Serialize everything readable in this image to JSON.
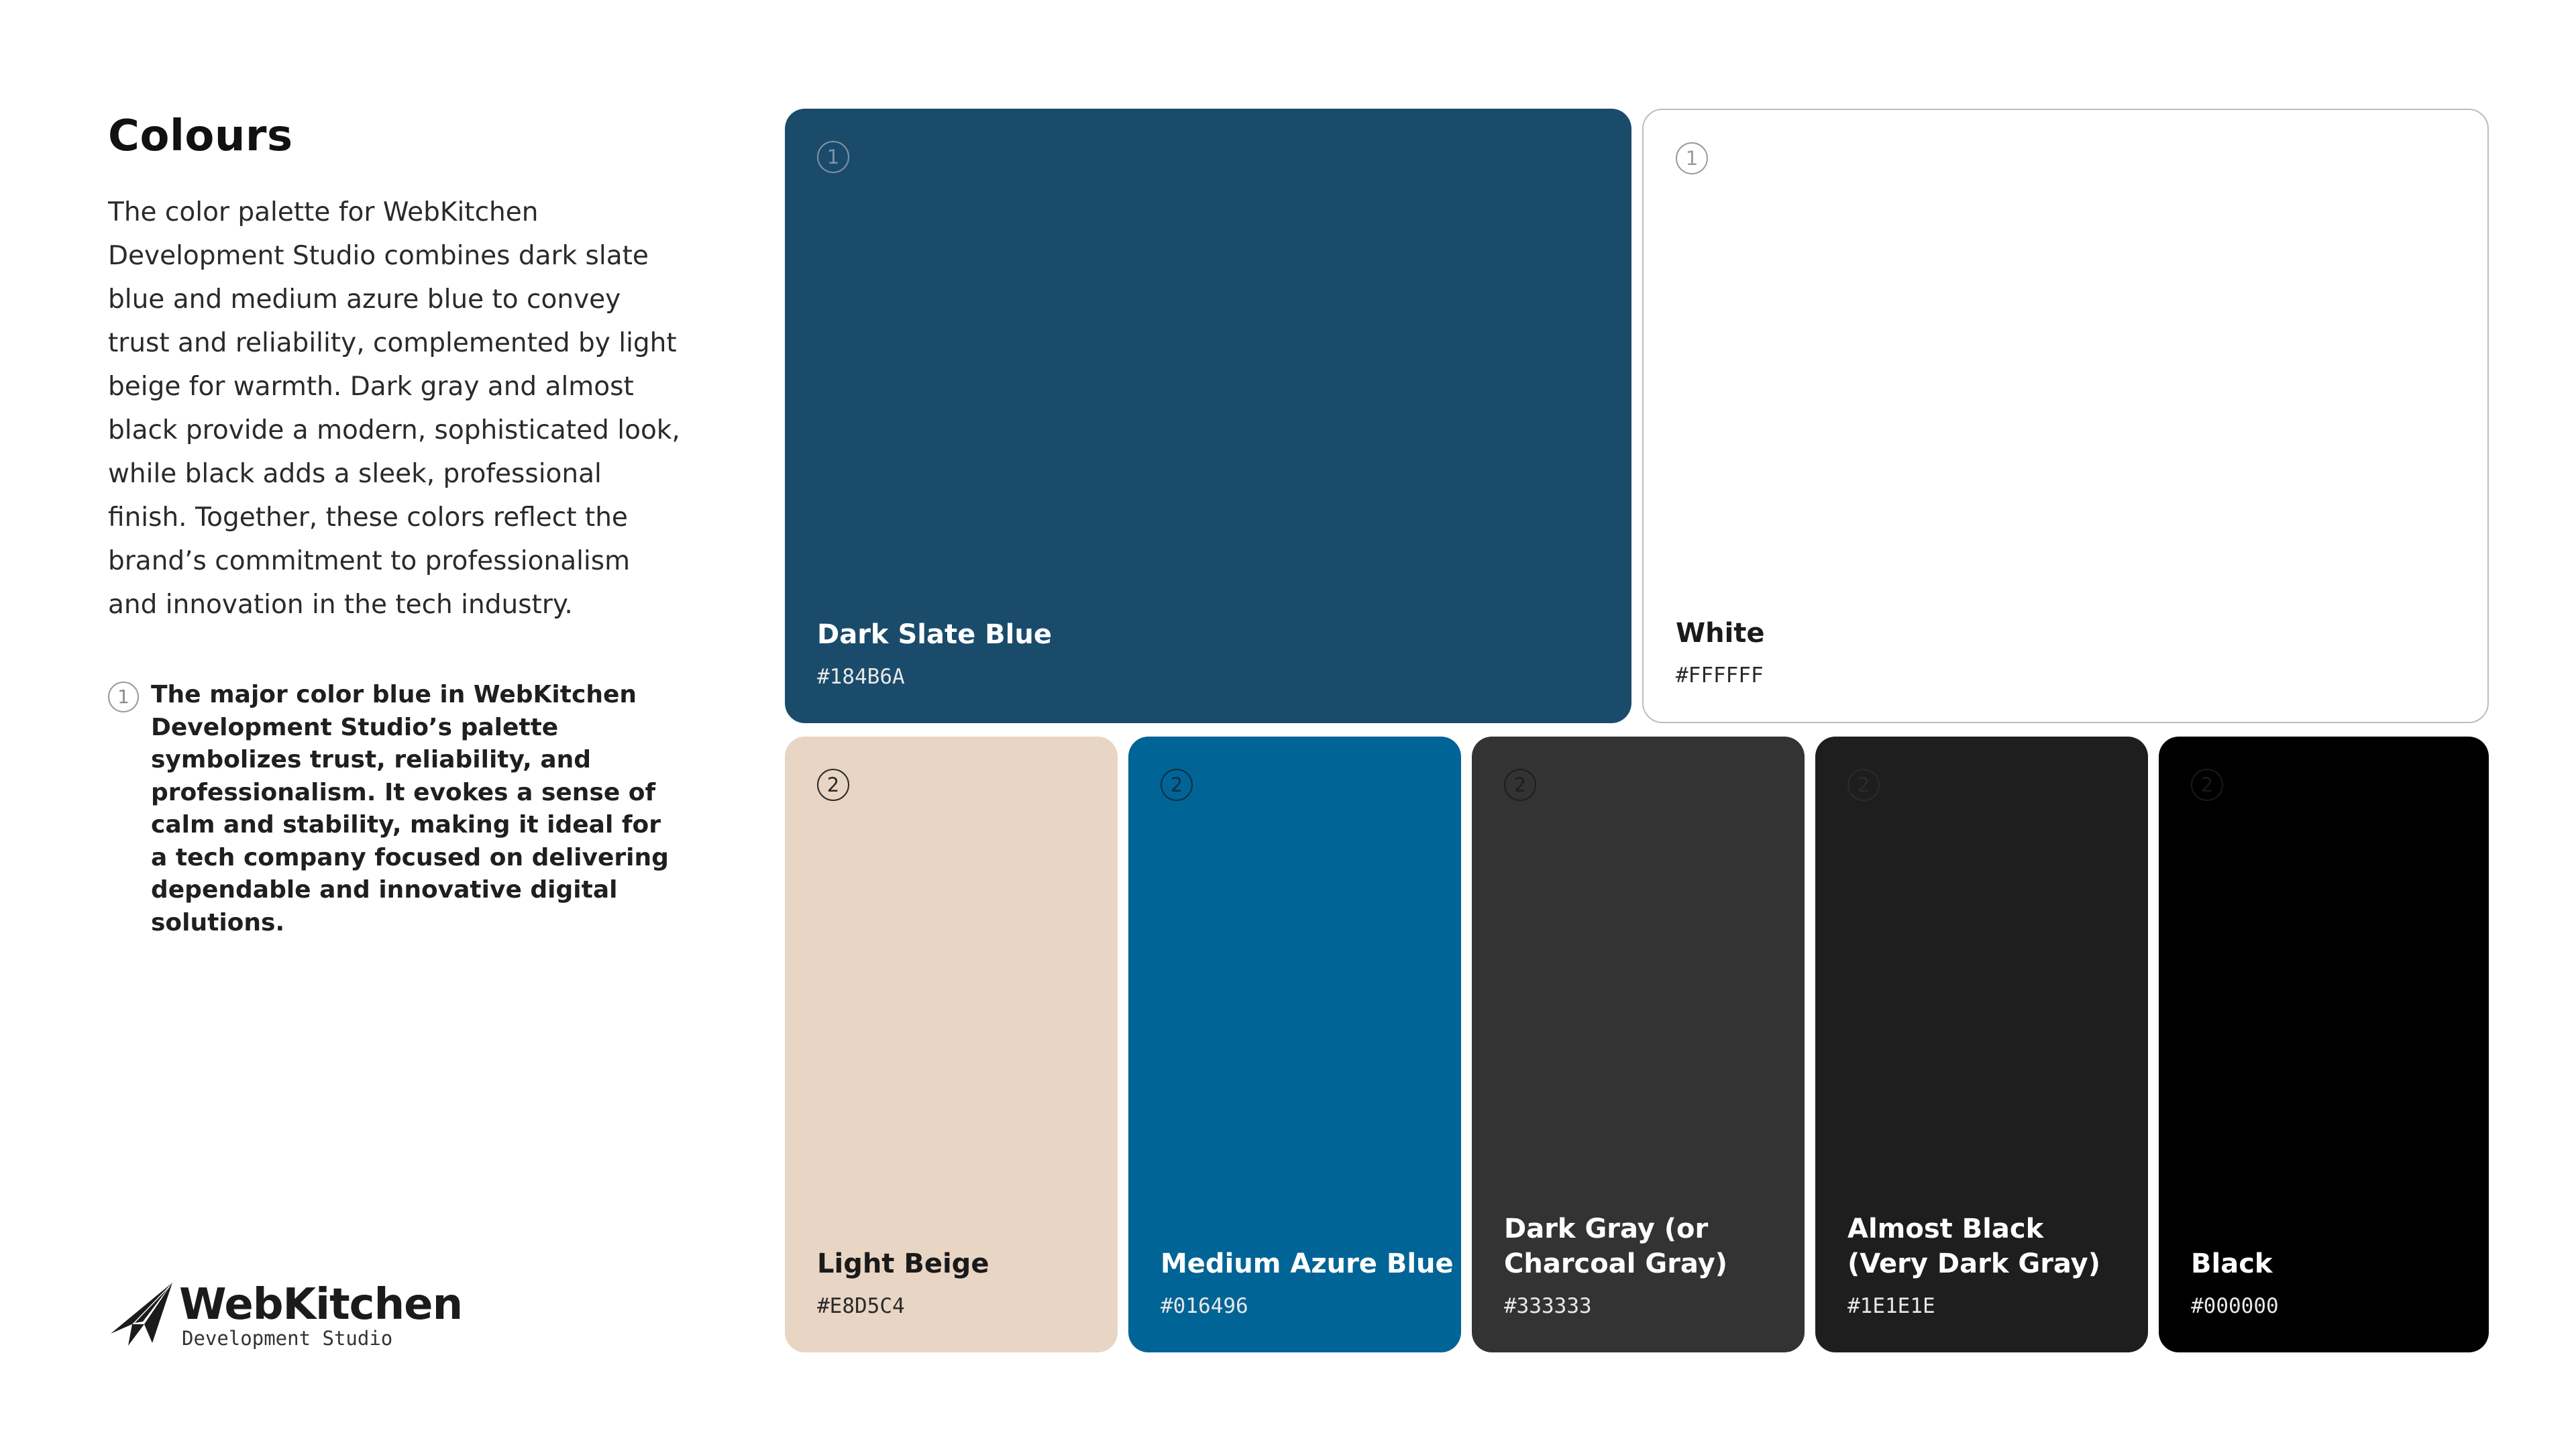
{
  "heading": "Colours",
  "description": "The color palette for WebKitchen Development Studio combines dark slate blue and medium azure blue to convey trust and reliability, complemented by light beige for warmth. Dark gray and almost black provide a modern, sophisticated look, while black adds a sleek, professional finish. Together, these colors reflect the brand’s commitment to professionalism and innovation in the tech industry.",
  "note": {
    "number": "1",
    "text": "The major color blue in WebKitchen Development Studio’s palette symbolizes trust, reliability, and professionalism. It evokes a sense of calm and stability, making it ideal for a tech company focused on delivering dependable and innovative digital solutions."
  },
  "logo": {
    "name": "WebKitchen",
    "subtitle": "Development Studio",
    "icon": "paper-plane-logo-icon"
  },
  "swatches": [
    {
      "name": "Dark Slate Blue",
      "hex": "#184B6A",
      "group": "1",
      "color": "#1A4B6B"
    },
    {
      "name": "White",
      "hex": "#FFFFFF",
      "group": "1",
      "color": "#FFFFFF"
    },
    {
      "name": "Light Beige",
      "hex": "#E8D5C4",
      "group": "2",
      "color": "#E8D5C4"
    },
    {
      "name": "Medium Azure Blue",
      "hex": "#016496",
      "group": "2",
      "color": "#016496"
    },
    {
      "name": "Dark Gray (or Charcoal Gray)",
      "hex": "#333333",
      "group": "2",
      "color": "#333333"
    },
    {
      "name": "Almost Black (Very Dark Gray)",
      "hex": "#1E1E1E",
      "group": "2",
      "color": "#1E1E1E"
    },
    {
      "name": "Black",
      "hex": "#000000",
      "group": "2",
      "color": "#000000"
    }
  ]
}
